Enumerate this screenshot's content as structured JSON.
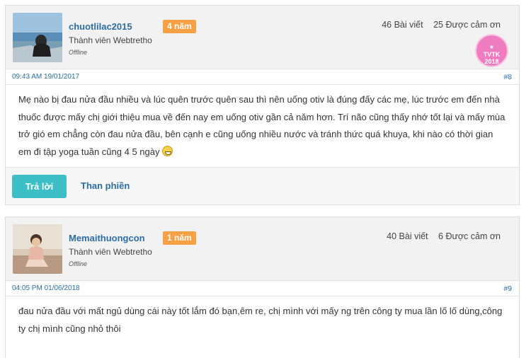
{
  "posts": [
    {
      "username": "chuotlilac2015",
      "tenure_badge": "4 năm",
      "role": "Thành viên Webtretho",
      "status": "Offline",
      "posts_count": "46 Bài viết",
      "thanks_count": "25 Được cảm ơn",
      "award_badge": {
        "line1": "TVTK",
        "line2": "2018"
      },
      "timestamp": "09:43 AM 19/01/2017",
      "post_number": "#8",
      "content": "Mẹ nào bị đau nửa đầu nhiều và lúc quên trước quên sau thì nên uống otiv là đúng đấy các mẹ, lúc trước em đến nhà thuốc được mấy chị giới thiệu mua về đến nay em uống otiv gần cả năm hơn. Trí não cũng thấy nhớ tốt lại và mấy mùa trở gió em chẳng còn đau nửa đầu, bên cạnh e cũng uống nhiều nước và tránh thức quá khuya, khi nào có thời gian em đi tập yoga tuần cũng 4 5 ngày",
      "reply_label": "Trả lời",
      "report_label": "Than phiền"
    },
    {
      "username": "Memaithuongcon",
      "tenure_badge": "1 năm",
      "role": "Thành viên Webtretho",
      "status": "Offline",
      "posts_count": "40 Bài viết",
      "thanks_count": "6 Được cảm ơn",
      "timestamp": "04:05 PM 01/06/2018",
      "post_number": "#9",
      "content": "đau nửa đầu với mất ngủ dùng cái này tốt lắm đó bạn,êm re, chị mình với mấy ng trên công ty mua lần lố lố dùng,công ty chị mình cũng nhỏ thôi"
    }
  ],
  "colors": {
    "link_blue": "#2c6da4",
    "badge_orange": "#f7a044",
    "reply_teal": "#3ebfc8",
    "award_pink": "#f07cc0"
  }
}
